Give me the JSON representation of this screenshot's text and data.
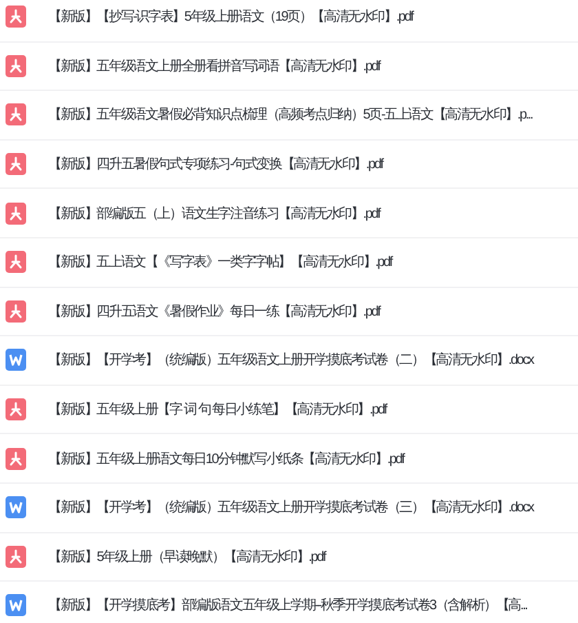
{
  "files": [
    {
      "kind": "pdf",
      "name": "【新版】【抄写-识字表】5年级上册语文（19页）【高清无水印】.pdf"
    },
    {
      "kind": "pdf",
      "name": "【新版】五年级语文上册全册看拼音写词语【高清无水印】.pdf"
    },
    {
      "kind": "pdf",
      "name": "【新版】五年级语文暑假必背知识点梳理（高频考点归纳）5页-五上语文【高清无水印】.p..."
    },
    {
      "kind": "pdf",
      "name": "【新版】四升五暑假句式专项练习-句式变换【高清无水印】.pdf"
    },
    {
      "kind": "pdf",
      "name": "【新版】部编版五（上）语文生字注音练习【高清无水印】.pdf"
    },
    {
      "kind": "pdf",
      "name": "【新版】五上语文【《写字表》一类字字帖】【高清无水印】.pdf"
    },
    {
      "kind": "pdf",
      "name": "【新版】四升五语文《暑假作业》每日一练【高清无水印】.pdf"
    },
    {
      "kind": "word",
      "name": "【新版】【开学考】（统编版）五年级语文上册开学摸底考试卷（二）【高清无水印】.docx"
    },
    {
      "kind": "pdf",
      "name": "【新版】五年级上册【字 词 句 每日小练笔】【高清无水印】.pdf"
    },
    {
      "kind": "pdf",
      "name": "【新版】五年级上册语文每日10分钟默写小纸条【高清无水印】.pdf"
    },
    {
      "kind": "word",
      "name": "【新版】【开学考】（统编版）五年级语文上册开学摸底考试卷（三）【高清无水印】.docx"
    },
    {
      "kind": "pdf",
      "name": "【新版】5年级上册（早读晚默）【高清无水印】.pdf"
    },
    {
      "kind": "word",
      "name": "【新版】【开学摸底考】部编版语文五年级上学期--秋季开学摸底考试卷3（含解析）【高..."
    }
  ]
}
